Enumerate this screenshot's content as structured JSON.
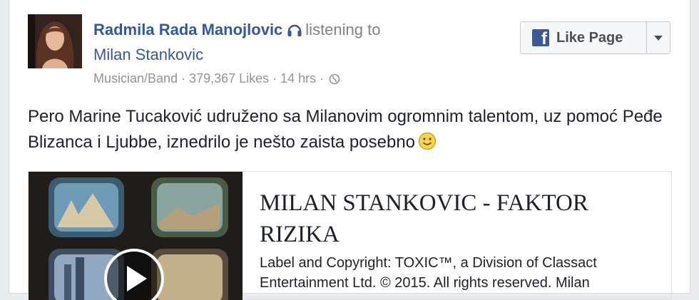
{
  "post": {
    "author": "Radmila Rada Manojlovic",
    "action": "listening to",
    "target": "Milan Stankovic",
    "meta": "Musician/Band · 379,367 Likes · 14 hrs · ",
    "text": "Pero Marine Tucaković udruženo sa Milanovim ogromnim talentom, uz pomoć Peđe Blizanca i Ljubbe, iznedrilo je nešto zaista posebno",
    "icons": {
      "activity": "headphones-icon",
      "privacy": "globe-icon",
      "emoji": "smiley-icon"
    }
  },
  "like_page": {
    "label": "Like Page",
    "logo": "f",
    "brand_color": "#3b5998"
  },
  "attachment": {
    "title": "MILAN STANKOVIC - FAKTOR RIZIKA",
    "description": "Label and Copyright: TOXIC™, a Division of Classact Entertainment Ltd. © 2015. All rights reserved. Milan"
  },
  "colors": {
    "link": "#365899",
    "meta": "#90949c",
    "text": "#1d2129"
  }
}
